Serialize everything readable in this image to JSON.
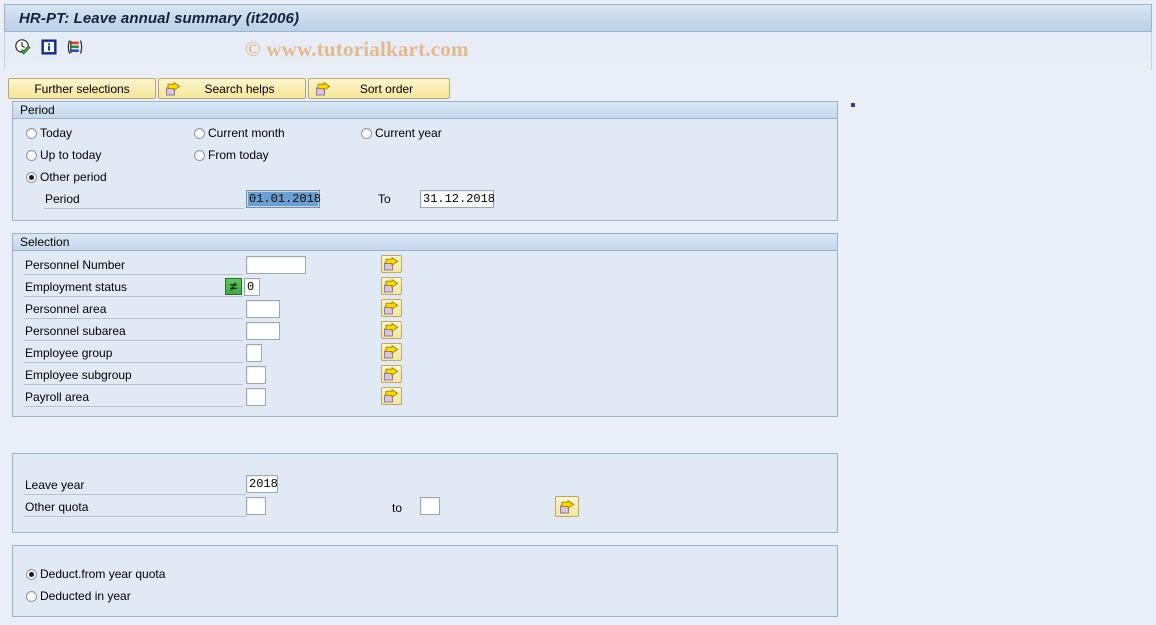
{
  "window": {
    "title": "HR-PT: Leave annual summary (it2006)"
  },
  "watermark": "© www.tutorialkart.com",
  "toolbar": {
    "icons": [
      {
        "name": "execute-clock-icon",
        "title": "Execute"
      },
      {
        "name": "information-icon",
        "title": "Information"
      },
      {
        "name": "variant-icon",
        "title": "Get Variant"
      }
    ]
  },
  "buttons": {
    "further_selections": "Further selections",
    "search_helps": "Search helps",
    "sort_order": "Sort order"
  },
  "period": {
    "header": "Period",
    "options": [
      {
        "label": "Today",
        "selected": false
      },
      {
        "label": "Current month",
        "selected": false
      },
      {
        "label": "Current year",
        "selected": false
      },
      {
        "label": "Up to today",
        "selected": false
      },
      {
        "label": "From today",
        "selected": false
      },
      {
        "label": "Other period",
        "selected": true
      }
    ],
    "period_label": "Period",
    "period_from": "01.01.2018",
    "to_label": "To",
    "period_to": "31.12.2018"
  },
  "selection": {
    "header": "Selection",
    "rows": [
      {
        "label": "Personnel Number",
        "value": "",
        "operator": "",
        "has_operator": false
      },
      {
        "label": "Employment status",
        "value": "0",
        "operator": "≠",
        "has_operator": true
      },
      {
        "label": "Personnel area",
        "value": "",
        "operator": "",
        "has_operator": false
      },
      {
        "label": "Personnel subarea",
        "value": "",
        "operator": "",
        "has_operator": false
      },
      {
        "label": "Employee group",
        "value": "",
        "operator": "",
        "has_operator": false
      },
      {
        "label": "Employee subgroup",
        "value": "",
        "operator": "",
        "has_operator": false
      },
      {
        "label": "Payroll area",
        "value": "",
        "operator": "",
        "has_operator": false
      }
    ]
  },
  "quota": {
    "leave_year_label": "Leave year",
    "leave_year_value": "2018",
    "other_quota_label": "Other quota",
    "other_quota_from": "",
    "to_label": "to",
    "other_quota_to": ""
  },
  "deduction": {
    "options": [
      {
        "label": "Deduct.from year quota",
        "selected": true
      },
      {
        "label": "Deducted in year",
        "selected": false
      }
    ]
  },
  "colors": {
    "accent": "#c6d8ec",
    "panel_bg": "#e1eaf4",
    "page_bg": "#eaeff7",
    "button_yellow": "#f8ecb0",
    "operator_green": "#3ea83e",
    "watermark": "#e5b98a",
    "selection_blue": "#6a9fd4"
  }
}
